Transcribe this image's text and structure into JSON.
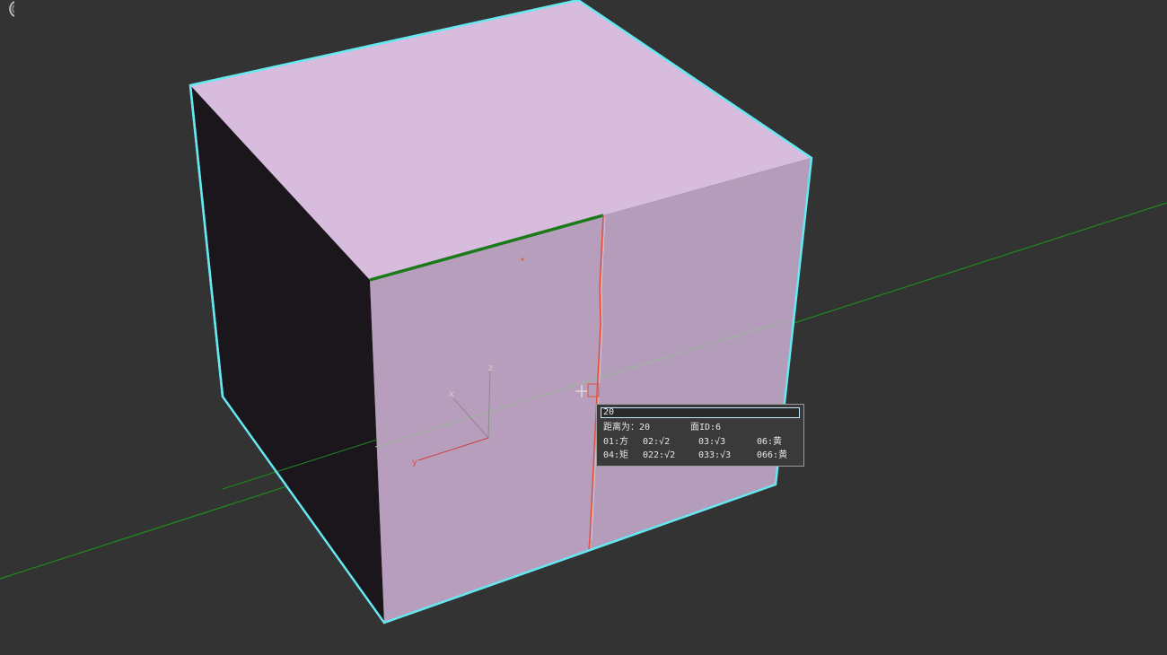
{
  "viewport": {
    "background": "#333333",
    "cube_top_color": "#d8bcdd",
    "cube_front_color": "#b49cbb",
    "cube_side_color": "#1b161c",
    "selection_outline_color": "#66e8f0",
    "grid_axis_color": "#1e8a1e",
    "selected_edge_color": "#1a7a1a",
    "cut_line_color": "#e0503a"
  },
  "gizmo": {
    "x_label": "x",
    "y_label": "y",
    "z_label": "z"
  },
  "hud": {
    "input_value": "20",
    "row1": {
      "distance": "距离为：20",
      "face_id": "面ID:6"
    },
    "row2": [
      "01:方",
      "02:√2",
      "03:√3",
      "06:黄"
    ],
    "row3": [
      "04:矩",
      "022:√2",
      "033:√3",
      "066:黄"
    ]
  },
  "icons": {
    "cursor": "crosshair-cursor-icon",
    "corner": "viewport-corner-icon"
  }
}
